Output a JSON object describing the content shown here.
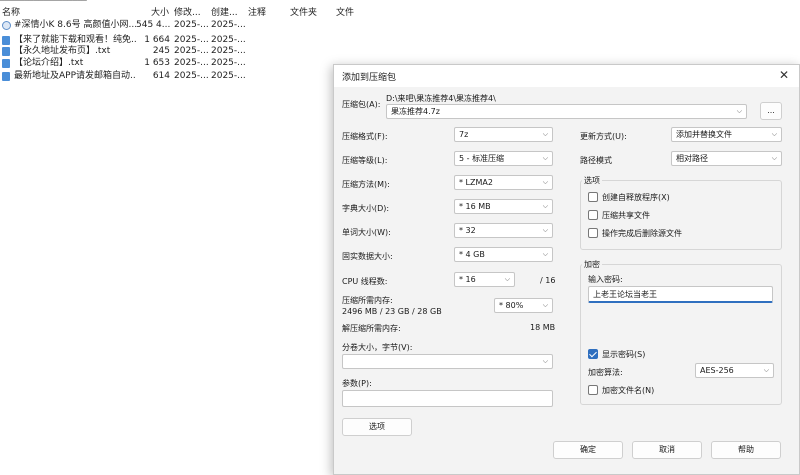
{
  "file_list": {
    "columns": {
      "name": "名称",
      "size": "大小",
      "modified": "修改...",
      "created": "创建...",
      "comment": "注释",
      "folders": "文件夹",
      "files": "文件"
    },
    "rows": [
      {
        "icon": "settings-file-icon",
        "name": "#深情小K 8.6号 高颜值小网...",
        "size": "545 4...",
        "modified": "2025-...",
        "created": "2025-..."
      },
      {
        "icon": "text-file-icon",
        "name": "【来了就能下载和观看！纯免...",
        "size": "1 664",
        "modified": "2025-...",
        "created": "2025-..."
      },
      {
        "icon": "text-file-icon",
        "name": "【永久地址发布页】.txt",
        "size": "245",
        "modified": "2025-...",
        "created": "2025-..."
      },
      {
        "icon": "text-file-icon",
        "name": "【论坛介绍】.txt",
        "size": "1 653",
        "modified": "2025-...",
        "created": "2025-..."
      },
      {
        "icon": "text-file-icon",
        "name": "最新地址及APP请发邮箱自动...",
        "size": "614",
        "modified": "2025-...",
        "created": "2025-..."
      }
    ]
  },
  "dialog": {
    "title": "添加到压缩包",
    "archive_label": "压缩包(A):",
    "archive_path": "D:\\来吧\\果冻推荐4\\果冻推荐4\\",
    "archive_name": "果冻推荐4.7z",
    "browse_label": "...",
    "format_label": "压缩格式(F):",
    "format_value": "7z",
    "level_label": "压缩等级(L):",
    "level_value": "5 - 标准压缩",
    "method_label": "压缩方法(M):",
    "method_value": "* LZMA2",
    "dict_label": "字典大小(D):",
    "dict_value": "* 16 MB",
    "word_label": "单词大小(W):",
    "word_value": "* 32",
    "solid_label": "固实数据大小:",
    "solid_value": "* 4 GB",
    "threads_label": "CPU 线程数:",
    "threads_value": "* 16",
    "threads_total": "/ 16",
    "mem_comp_label": "压缩所需内存:",
    "mem_comp_value": "2496 MB / 23 GB / 28 GB",
    "mem_percent": "* 80%",
    "mem_decomp_label": "解压缩所需内存:",
    "mem_decomp_value": "18 MB",
    "split_label": "分卷大小，字节(V):",
    "split_value": "",
    "params_label": "参数(P):",
    "params_value": "",
    "options_button": "选项",
    "update_label": "更新方式(U):",
    "update_value": "添加并替换文件",
    "pathmode_label": "路径模式",
    "pathmode_value": "相对路径",
    "options_group": {
      "title": "选项",
      "sfx": "创建自释放程序(X)",
      "shared": "压缩共享文件",
      "delete_after": "操作完成后删除源文件"
    },
    "encryption": {
      "title": "加密",
      "password_label": "输入密码:",
      "password_value": "上老王论坛当老王",
      "show_password": "显示密码(S)",
      "method_label": "加密算法:",
      "method_value": "AES-256",
      "encrypt_names": "加密文件名(N)"
    },
    "ok_button": "确定",
    "cancel_button": "取消",
    "help_button": "帮助"
  }
}
